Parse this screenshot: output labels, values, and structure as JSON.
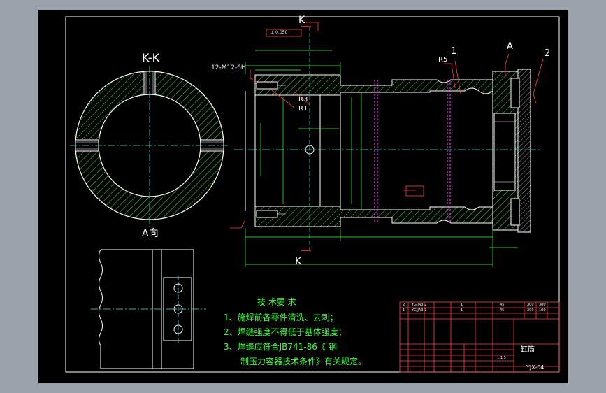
{
  "section_view": {
    "title": "K-K",
    "view_label": "A向"
  },
  "section_marks": {
    "top": "K",
    "bottom": "K"
  },
  "annotations": {
    "thread": "12-M12-6H",
    "radius_r5": "R5",
    "radius_r3": "R3",
    "radius_r1": "R1",
    "datum_a": "A",
    "balloon_1": "1",
    "balloon_2": "2",
    "perpendicularity": "⊥ 0.050"
  },
  "tech_requirements": {
    "heading": "技 术要 求",
    "items": [
      "1、施焊前各零件清洗、去刺；",
      "2、焊缝强度不得低于基体强度；",
      "3、焊缝应符合JB741-86《   钢",
      "制压力容器技术条件》有关规定。"
    ]
  },
  "title_block": {
    "parts": [
      {
        "no": "2",
        "code": "YGJJA3-2",
        "qty": "1",
        "mat": "45",
        "w1": "300",
        "w2": "300"
      },
      {
        "no": "1",
        "code": "YGJJA3-1",
        "qty": "1",
        "mat": "45",
        "w1": "300",
        "w2": "100"
      }
    ],
    "drawing_name": "缸筒",
    "drawing_number": "YJX-04",
    "scale_text": "1:1.5"
  },
  "colors": {
    "sheet": "#000000",
    "frame": "#ffffff",
    "hatch": "#3fff3f",
    "center": "#4de1e1",
    "dimension": "#3fff3f",
    "leader": "#ff4040",
    "title_grid": "#ff4040",
    "text_green": "#3fff3f",
    "text_yellow": "#ffff3f",
    "weld_line": "#ff3fff"
  }
}
